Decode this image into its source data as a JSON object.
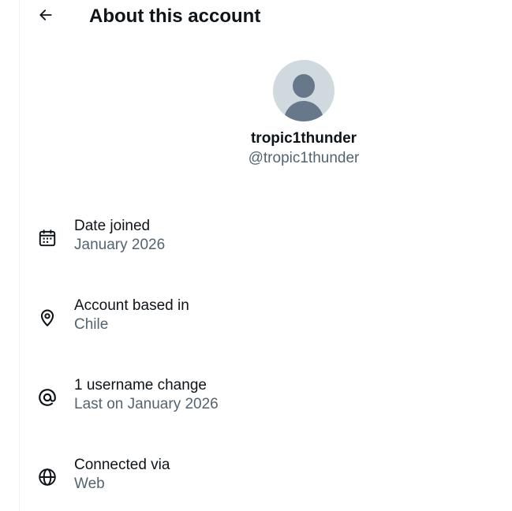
{
  "header": {
    "title": "About this account",
    "back_icon": "arrow-left-icon"
  },
  "profile": {
    "display_name": "tropic1thunder",
    "handle": "@tropic1thunder",
    "avatar": "default-avatar"
  },
  "info": [
    {
      "icon": "calendar-icon",
      "title": "Date joined",
      "value": "January 2026"
    },
    {
      "icon": "location-pin-icon",
      "title": "Account based in",
      "value": "Chile"
    },
    {
      "icon": "at-sign-icon",
      "title": "1 username change",
      "value": "Last on January 2026"
    },
    {
      "icon": "globe-icon",
      "title": "Connected via",
      "value": "Web"
    }
  ],
  "colors": {
    "text_primary": "#0f1419",
    "text_secondary": "#536471",
    "avatar_bg": "#cfd9de",
    "avatar_fg": "#66788a"
  }
}
